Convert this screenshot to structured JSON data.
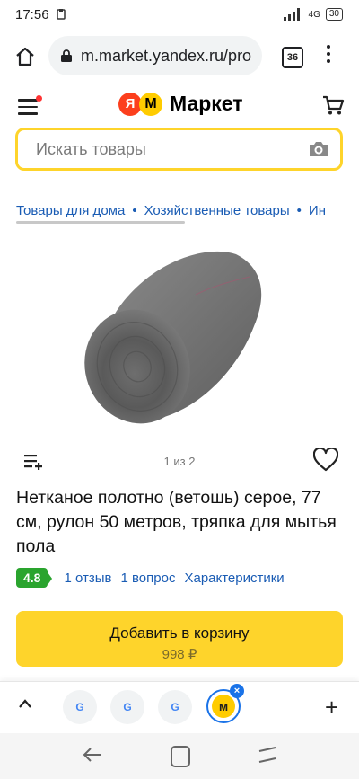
{
  "status": {
    "time": "17:56",
    "network": "4G",
    "battery": "30"
  },
  "browser": {
    "url": "m.market.yandex.ru/pro",
    "tab_count": "36"
  },
  "header": {
    "logo_letter": "Я",
    "logo_m": "М",
    "logo_text": "Маркет"
  },
  "search": {
    "placeholder": "Искать товары"
  },
  "breadcrumbs": [
    "Товары для дома",
    "Хозяйственные товары",
    "Ин"
  ],
  "product": {
    "pager": "1 из 2",
    "title": "Нетканое полотно (ветошь) серое, 77 см, рулон 50 метров, тряпка для мытья пола",
    "rating": "4.8",
    "reviews": "1 отзыв",
    "questions": "1 вопрос",
    "specs": "Характеристики"
  },
  "cart": {
    "label": "Добавить в корзину",
    "price": "998 ₽"
  },
  "tabs": {
    "google_letter": "G",
    "yandex_letter": "м",
    "close": "×",
    "new_tab": "+"
  },
  "colors": {
    "accent": "#fed42b",
    "link": "#1a5cb4",
    "rating": "#2aa42e"
  }
}
